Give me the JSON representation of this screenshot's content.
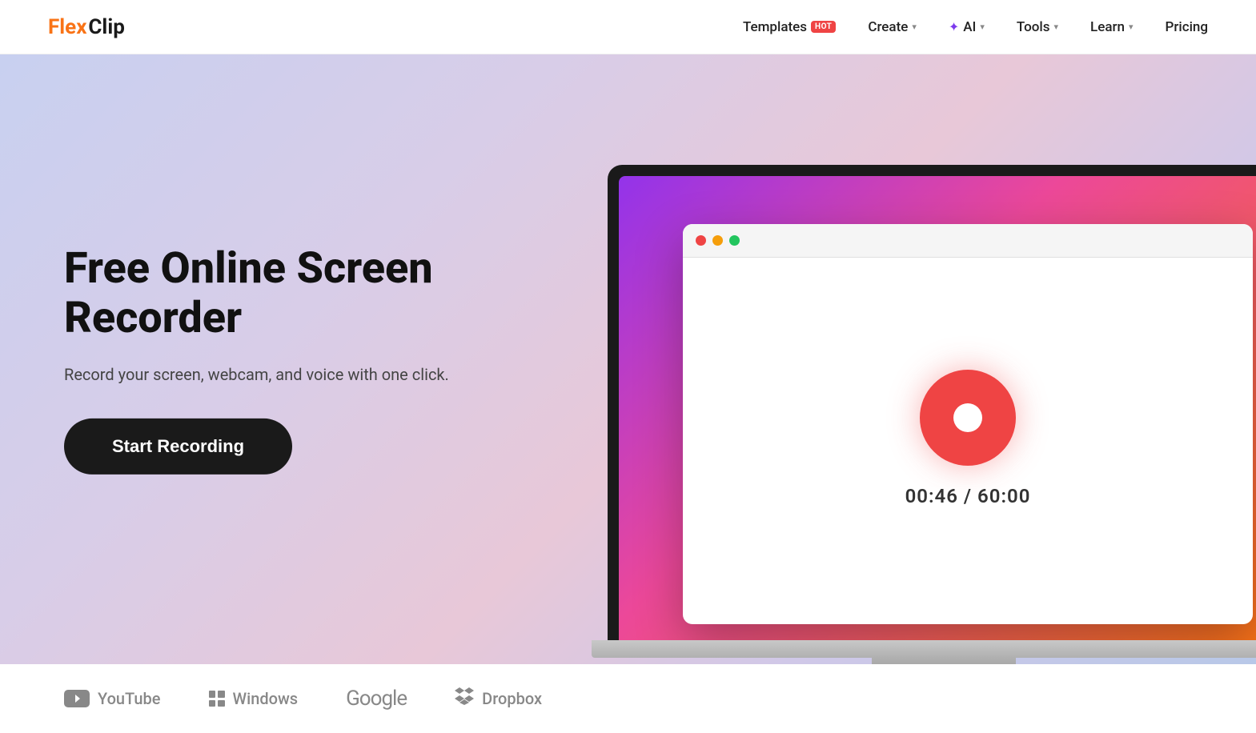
{
  "logo": {
    "flex": "Flex",
    "clip": "Clip"
  },
  "navbar": {
    "templates_label": "Templates",
    "templates_badge": "HOT",
    "create_label": "Create",
    "ai_label": "AI",
    "tools_label": "Tools",
    "learn_label": "Learn",
    "pricing_label": "Pricing"
  },
  "hero": {
    "title": "Free Online Screen Recorder",
    "subtitle": "Record your screen, webcam, and voice with one click.",
    "cta_label": "Start Recording"
  },
  "recorder": {
    "timer": "00:46 / 60:00"
  },
  "partners": [
    {
      "id": "youtube",
      "label": "YouTube"
    },
    {
      "id": "windows",
      "label": "Windows"
    },
    {
      "id": "google",
      "label": "Google"
    },
    {
      "id": "dropbox",
      "label": "Dropbox"
    }
  ]
}
